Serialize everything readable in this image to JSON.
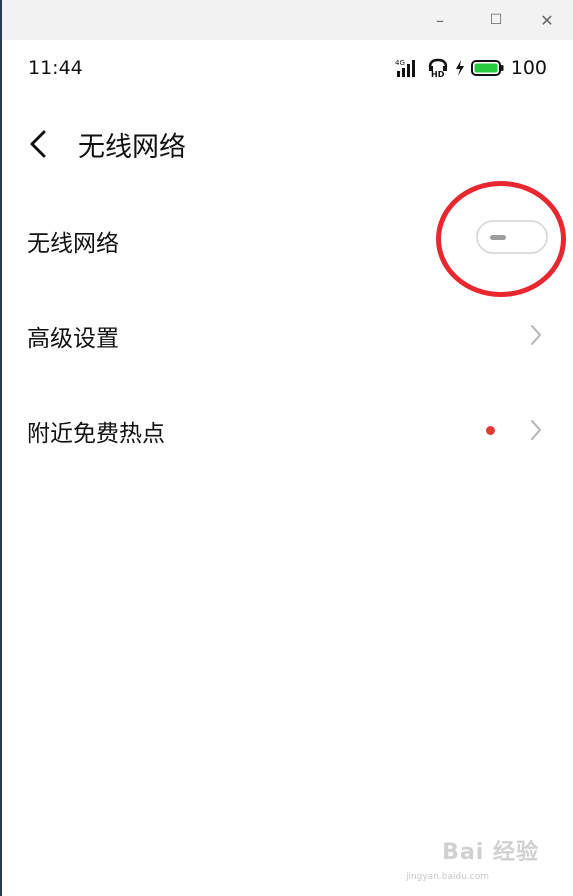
{
  "window": {
    "minimize_glyph": "–",
    "maximize_glyph": "☐",
    "close_glyph": "✕"
  },
  "status_bar": {
    "time": "11:44",
    "network": "4G",
    "hd": "HD",
    "battery_percent": "100",
    "battery_color": "#27c93f",
    "icons": [
      "signal-4g-icon",
      "hd-call-icon",
      "charging-bolt-icon",
      "battery-icon"
    ]
  },
  "header": {
    "title": "无线网络"
  },
  "settings": {
    "wifi_label": "无线网络",
    "wifi_enabled": false,
    "advanced_label": "高级设置",
    "hotspot_label": "附近免费热点",
    "hotspot_badge_color": "#e53935"
  },
  "annotation": {
    "circle_color": "#e8272f"
  },
  "watermark": {
    "text": "Bai 经验",
    "sub": "jingyan.baidu.com"
  }
}
